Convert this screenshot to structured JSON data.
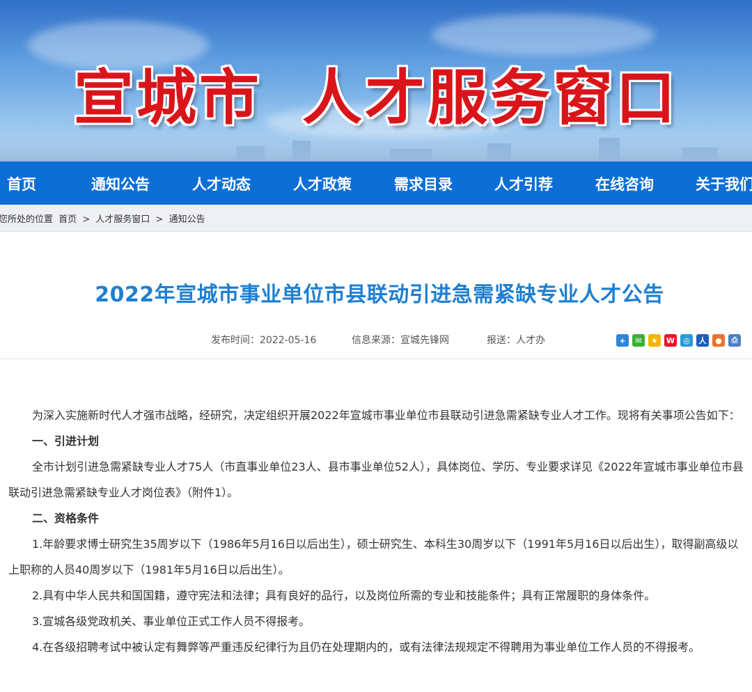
{
  "banner": {
    "title_left": "宣城市",
    "title_right": "人才服务窗口"
  },
  "nav": [
    {
      "label": "首页"
    },
    {
      "label": "通知公告"
    },
    {
      "label": "人才动态"
    },
    {
      "label": "人才政策"
    },
    {
      "label": "需求目录"
    },
    {
      "label": "人才引荐"
    },
    {
      "label": "在线咨询"
    },
    {
      "label": "关于我们"
    }
  ],
  "breadcrumb": {
    "prefix": "您所处的位置",
    "items": [
      "首页",
      "人才服务窗口",
      "通知公告"
    ],
    "sep": ">"
  },
  "article": {
    "title": "2022年宣城市事业单位市县联动引进急需紧缺专业人才公告",
    "publish_time": "发布时间：2022-05-16",
    "source": "信息来源：宣城先锋网",
    "report": "报送：人才办"
  },
  "share_icons": [
    {
      "name": "plus-share-icon",
      "glyph": "+",
      "color": "#2d86d9"
    },
    {
      "name": "wechat-icon",
      "glyph": "✉",
      "color": "#3cb034"
    },
    {
      "name": "qzone-icon",
      "glyph": "★",
      "color": "#f5b400"
    },
    {
      "name": "weibo-icon",
      "glyph": "W",
      "color": "#e6162d"
    },
    {
      "name": "tencent-weibo-icon",
      "glyph": "◎",
      "color": "#2a9bd8"
    },
    {
      "name": "renren-icon",
      "glyph": "人",
      "color": "#1c5fb8"
    },
    {
      "name": "kaixin-icon",
      "glyph": "●",
      "color": "#e8742d"
    },
    {
      "name": "print-icon",
      "glyph": "⎙",
      "color": "#4a7fc1"
    }
  ],
  "content": {
    "intro": "为深入实施新时代人才强市战略，经研究，决定组织开展2022年宣城市事业单位市县联动引进急需紧缺专业人才工作。现将有关事项公告如下：",
    "s1_title": "一、引进计划",
    "s1_p1": "全市计划引进急需紧缺专业人才75人（市直事业单位23人、县市事业单位52人），具体岗位、学历、专业要求详见《2022年宣城市事业单位市县联动引进急需紧缺专业人才岗位表》（附件1）。",
    "s2_title": "二、资格条件",
    "s2_p1": "1.年龄要求博士研究生35周岁以下（1986年5月16日以后出生），硕士研究生、本科生30周岁以下（1991年5月16日以后出生），取得副高级以上职称的人员40周岁以下（1981年5月16日以后出生）。",
    "s2_p2": "2.具有中华人民共和国国籍，遵守宪法和法律；具有良好的品行，以及岗位所需的专业和技能条件；具有正常履职的身体条件。",
    "s2_p3": "3.宣城各级党政机关、事业单位正式工作人员不得报考。",
    "s2_p4": "4.在各级招聘考试中被认定有舞弊等严重违反纪律行为且仍在处理期内的，或有法律法规规定不得聘用为事业单位工作人员的不得报考。"
  }
}
